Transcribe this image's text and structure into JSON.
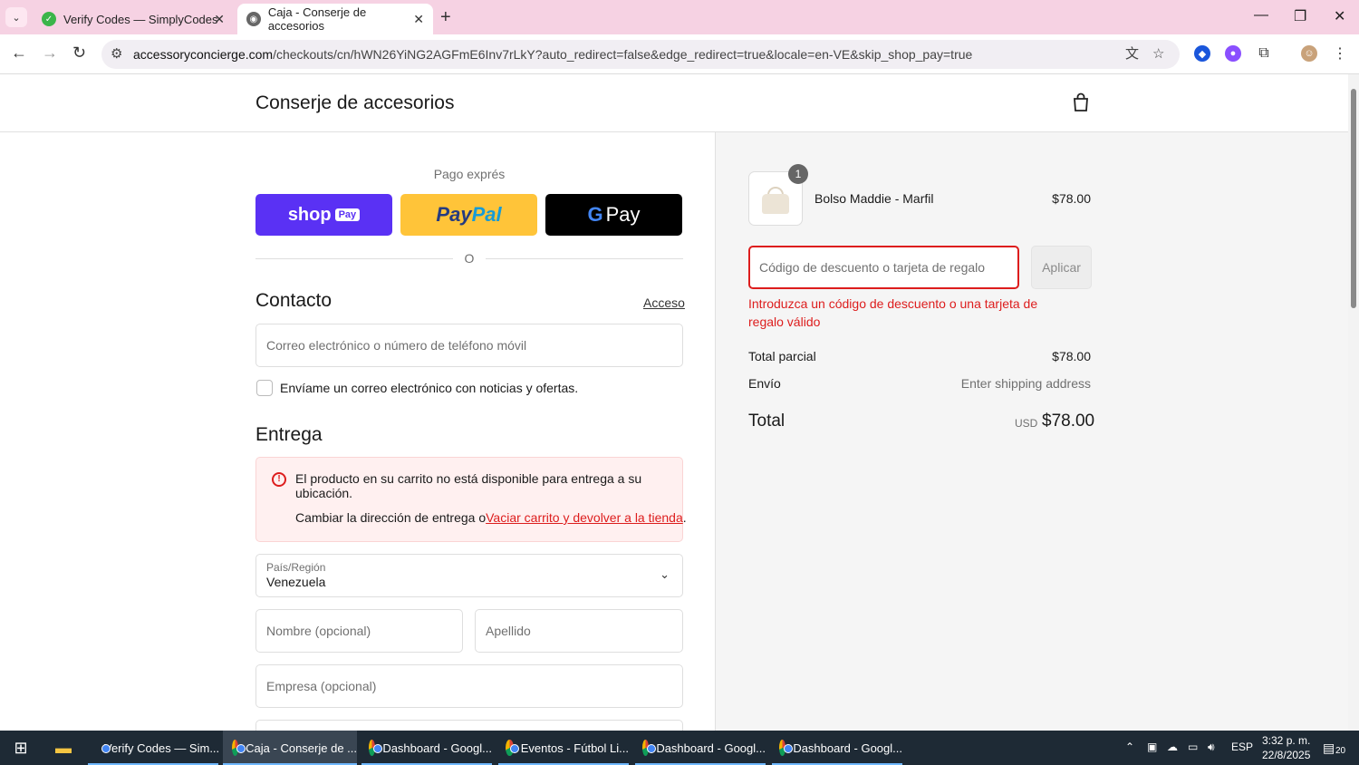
{
  "browser": {
    "tabs": [
      {
        "title": "Verify Codes — SimplyCodes",
        "active": false
      },
      {
        "title": "Caja - Conserje de accesorios",
        "active": true
      }
    ],
    "url_host": "accessoryconcierge.com",
    "url_path": "/checkouts/cn/hWN26YiNG2AGFmE6Inv7rLkY?auto_redirect=false&edge_redirect=true&locale=en-VE&skip_shop_pay=true"
  },
  "header": {
    "store_name": "Conserje de accesorios"
  },
  "express": {
    "title": "Pago exprés",
    "shop_label": "shop",
    "shop_badge": "Pay",
    "paypal_a": "Pay",
    "paypal_b": "Pal",
    "gpay_g": "G",
    "gpay_label": "Pay",
    "or": "O"
  },
  "contact": {
    "title": "Contacto",
    "login_link": "Acceso",
    "email_placeholder": "Correo electrónico o número de teléfono móvil",
    "newsletter_label": "Envíame un correo electrónico con noticias y ofertas."
  },
  "delivery": {
    "title": "Entrega",
    "alert_text": "El producto en su carrito no está disponible para entrega a su ubicación.",
    "alert_change": "Cambiar la dirección de entrega o",
    "alert_link": "Vaciar carrito y devolver a la tienda",
    "alert_end": ".",
    "country_label": "País/Región",
    "country_value": "Venezuela",
    "first_name_placeholder": "Nombre (opcional)",
    "last_name_placeholder": "Apellido",
    "company_placeholder": "Empresa (opcional)"
  },
  "summary": {
    "product": {
      "name": "Bolso Maddie - Marfil",
      "price": "$78.00",
      "quantity": "1"
    },
    "discount_placeholder": "Código de descuento o tarjeta de regalo",
    "apply_label": "Aplicar",
    "discount_error": "Introduzca un código de descuento o una tarjeta de regalo válido",
    "subtotal_label": "Total parcial",
    "subtotal_value": "$78.00",
    "shipping_label": "Envío",
    "shipping_value": "Enter shipping address",
    "total_label": "Total",
    "total_currency": "USD",
    "total_value": "$78.00"
  },
  "taskbar": {
    "items": [
      "Verify Codes — Sim...",
      "Caja - Conserje de ...",
      "Dashboard - Googl...",
      "Eventos - Fútbol Li...",
      "Dashboard - Googl...",
      "Dashboard - Googl..."
    ],
    "lang": "ESP",
    "time": "3:32 p. m.",
    "date": "22/8/2025",
    "notifications": "20"
  },
  "colors": {
    "accent_error": "#dd1d1d",
    "shop_pay": "#5a31f4",
    "paypal": "#ffc439",
    "tab_bar": "#f6d2e3"
  }
}
